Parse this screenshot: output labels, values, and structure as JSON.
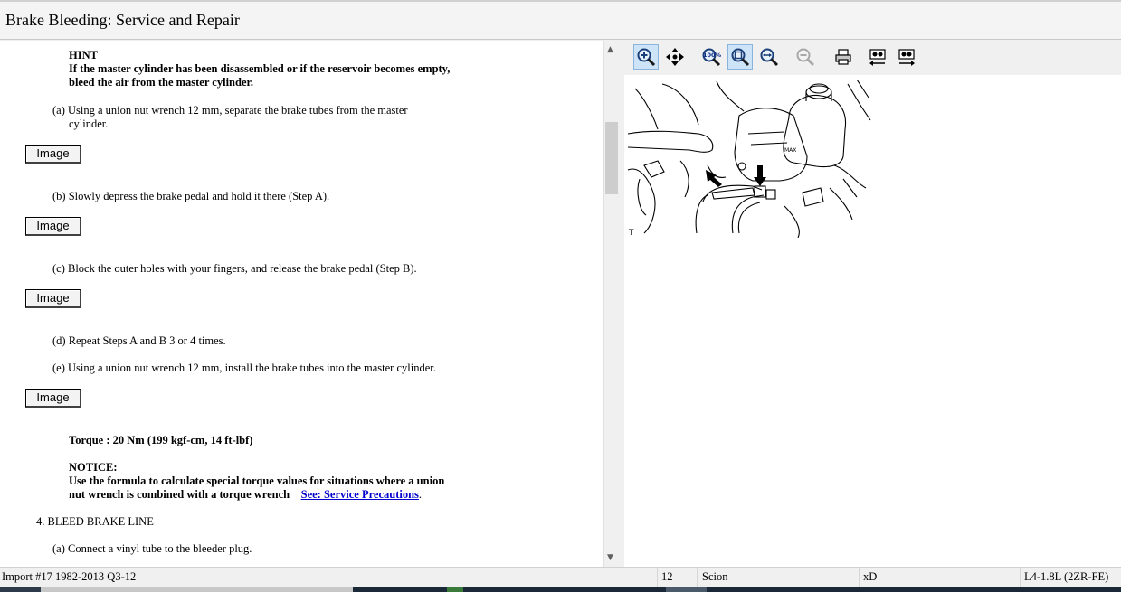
{
  "window": {
    "title": "Brake Bleeding:  Service and Repair"
  },
  "content": {
    "hint_heading": "HINT",
    "hint_line1": "If the master cylinder has been disassembled or if the reservoir becomes empty,",
    "hint_line2": "bleed the air from the master cylinder.",
    "step_a_line1": "(a) Using a union nut wrench 12 mm, separate the brake tubes from the master",
    "step_a_line2": "cylinder.",
    "step_b": "(b) Slowly depress the brake pedal and hold it there (Step A).",
    "step_c": "(c) Block the outer holes with your fingers, and release the brake pedal (Step B).",
    "step_d": "(d) Repeat Steps A and B 3 or 4 times.",
    "step_e": "(e) Using a union nut wrench 12 mm, install the brake tubes into the master cylinder.",
    "torque": "Torque : 20 Nm (199 kgf-cm, 14 ft-lbf)",
    "notice_heading": "NOTICE:",
    "notice_line1": "Use the formula to calculate special torque values for situations where a union",
    "notice_line2": "nut wrench is combined with a torque wrench",
    "notice_link": "See: Service Precautions",
    "notice_period": ".",
    "section4": "4.   BLEED BRAKE LINE",
    "step4a": "(a) Connect a vinyl tube to the bleeder plug.",
    "image_button_label": "Image"
  },
  "toolbar": {
    "icons": [
      "zoom-in-icon",
      "pan-icon",
      "zoom-100-icon",
      "zoom-fit-icon",
      "zoom-width-icon",
      "zoom-out-icon",
      "print-icon",
      "prev-image-icon",
      "next-image-icon"
    ]
  },
  "diagram": {
    "corner_label": "T"
  },
  "status": {
    "import": "Import #17 1982-2013 Q3-12",
    "year": "12",
    "make": "Scion",
    "model": "xD",
    "engine": "L4-1.8L (2ZR-FE)"
  }
}
